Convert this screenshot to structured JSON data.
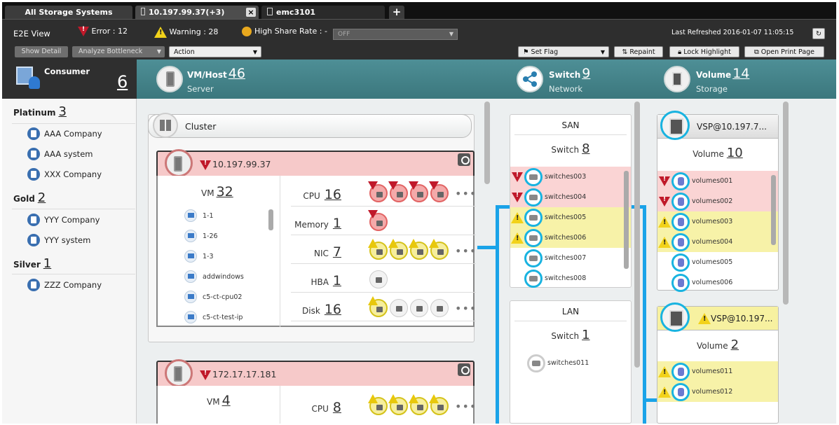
{
  "tabs": {
    "all": "All Storage Systems",
    "host": "10.197.99.37(+3)",
    "emc": "emc3101",
    "add": "+",
    "close": "×"
  },
  "toolbar": {
    "view": "E2E View",
    "error": "Error : 12",
    "warning": "Warning : 28",
    "high_share": "High Share Rate : -",
    "high_share_value": "OFF",
    "last_refreshed": "Last Refreshed 2016-01-07 11:05:15",
    "show_detail": "Show Detail",
    "analyze": "Analyze Bottleneck",
    "action": "Action",
    "set_flag": "Set Flag",
    "repaint": "Repaint",
    "lock": "Lock Highlight",
    "print": "Open Print Page"
  },
  "sidebar": {
    "consumer_label": "Consumer",
    "consumer_count": "6",
    "groups": [
      {
        "name": "Platinum",
        "count": "3",
        "items": [
          "AAA Company",
          "AAA system",
          "XXX Company"
        ]
      },
      {
        "name": "Gold",
        "count": "2",
        "items": [
          "YYY Company",
          "YYY system"
        ]
      },
      {
        "name": "Silver",
        "count": "1",
        "items": [
          "ZZZ Company"
        ]
      }
    ]
  },
  "banner": {
    "vmhost": {
      "title": "VM/Host",
      "count": "46",
      "sub": "Server"
    },
    "switch": {
      "title": "Switch",
      "count": "9",
      "sub": "Network"
    },
    "volume": {
      "title": "Volume",
      "count": "14",
      "sub": "Storage"
    }
  },
  "cluster": {
    "label": "Cluster"
  },
  "hosts": [
    {
      "name": "10.197.99.37",
      "vm_label": "VM",
      "vm_count": "32",
      "vms": [
        "1-1",
        "1-26",
        "1-3",
        "addwindows",
        "c5-ct-cpu02",
        "c5-ct-test-ip"
      ],
      "resources": [
        {
          "label": "CPU",
          "count": "16",
          "more": "•••"
        },
        {
          "label": "Memory",
          "count": "1",
          "more": ""
        },
        {
          "label": "NIC",
          "count": "7",
          "more": "•••"
        },
        {
          "label": "HBA",
          "count": "1",
          "more": ""
        },
        {
          "label": "Disk",
          "count": "16",
          "more": "•••"
        }
      ]
    },
    {
      "name": "172.17.17.181",
      "vm_label": "VM",
      "vm_count": "4",
      "resources": [
        {
          "label": "CPU",
          "count": "8",
          "more": "•••"
        }
      ]
    }
  ],
  "san": {
    "title": "SAN",
    "switch_label": "Switch",
    "switch_count": "8",
    "switches": [
      {
        "name": "switches003",
        "status": "error"
      },
      {
        "name": "switches004",
        "status": "error"
      },
      {
        "name": "switches005",
        "status": "warning"
      },
      {
        "name": "switches006",
        "status": "warning"
      },
      {
        "name": "switches007",
        "status": "normal"
      },
      {
        "name": "switches008",
        "status": "normal"
      }
    ]
  },
  "lan": {
    "title": "LAN",
    "switch_label": "Switch",
    "switch_count": "1",
    "switches": [
      {
        "name": "switches011"
      }
    ]
  },
  "storages": [
    {
      "name": "VSP@10.197.7...",
      "vol_label": "Volume",
      "vol_count": "10",
      "volumes": [
        {
          "name": "volumes001",
          "status": "error"
        },
        {
          "name": "volumes002",
          "status": "error"
        },
        {
          "name": "volumes003",
          "status": "warning"
        },
        {
          "name": "volumes004",
          "status": "warning"
        },
        {
          "name": "volumes005",
          "status": "normal"
        },
        {
          "name": "volumes006",
          "status": "normal"
        }
      ]
    },
    {
      "name": "VSP@10.197...",
      "vol_label": "Volume",
      "vol_count": "2",
      "volumes": [
        {
          "name": "volumes011",
          "status": "warning"
        },
        {
          "name": "volumes012",
          "status": "warning"
        }
      ]
    }
  ],
  "colors": {
    "banner": "#3b777d",
    "error": "#c0192a",
    "warning": "#f2d21a",
    "link": "#19b3e0"
  }
}
